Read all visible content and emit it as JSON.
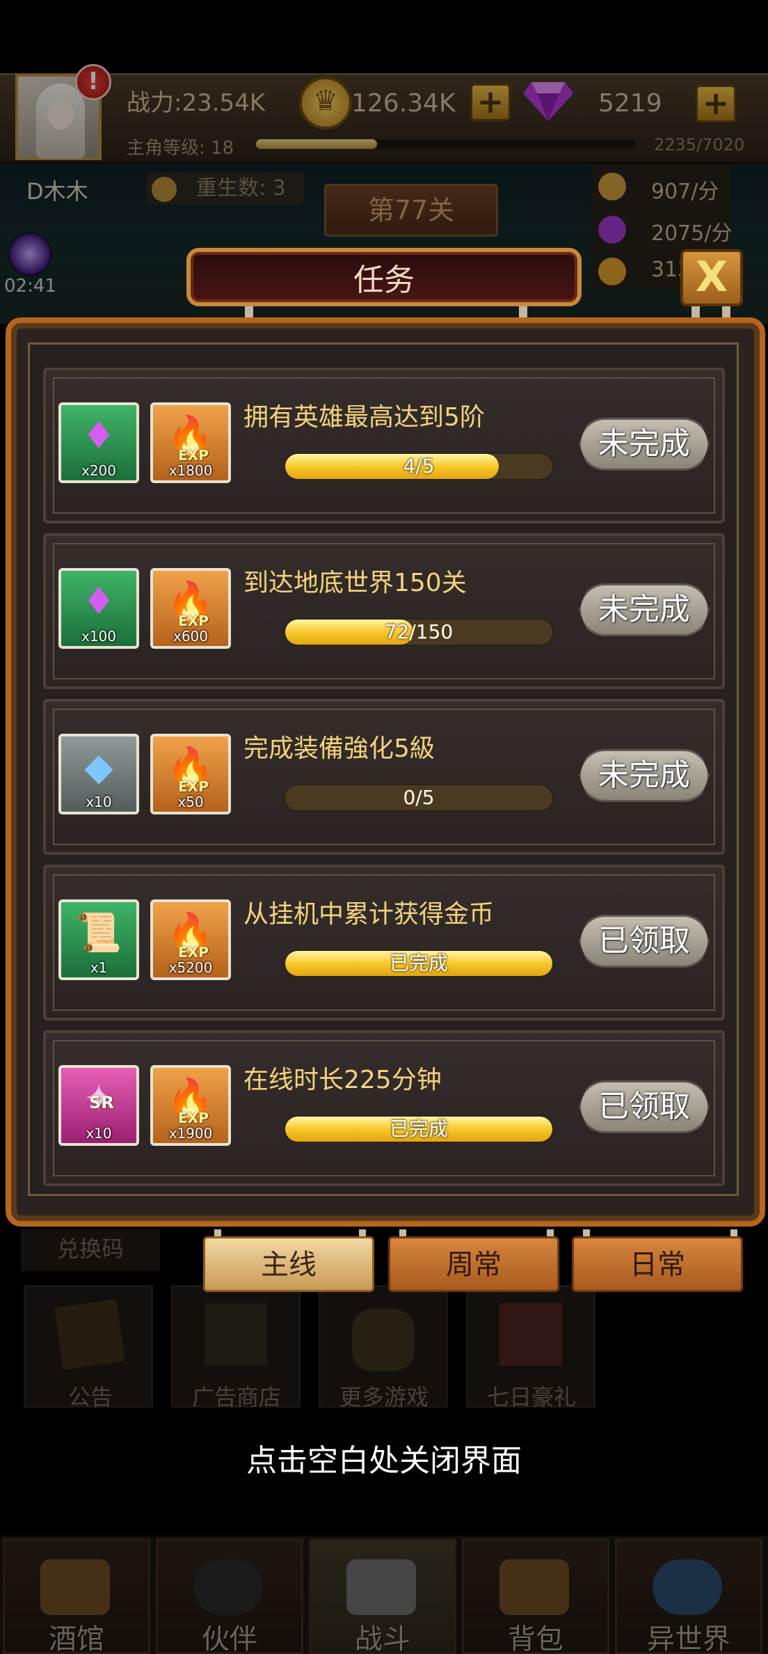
{
  "header": {
    "power": "战力:23.54K",
    "gold": "126.34K",
    "gems": "5219",
    "level_label": "主角等级: 18",
    "level_progress": "2235/7020",
    "level_fraction": 0.318,
    "alert": "!"
  },
  "scene": {
    "player_name": "D木木",
    "rebirth": "重生数: 3",
    "stage": "第77关",
    "rates": [
      "907/分",
      "2075/分",
      "313"
    ],
    "time": "02:41"
  },
  "dialog": {
    "title": "任务",
    "close_label": "X",
    "tasks": [
      {
        "title": "拥有英雄最高达到5阶",
        "progress_text": "4/5",
        "progress": 0.8,
        "status": "未完成",
        "rewards": [
          {
            "icon": "gem-icon",
            "qty": "x200",
            "color": "green"
          },
          {
            "icon": "exp-icon",
            "qty": "x1800",
            "color": "orange"
          }
        ]
      },
      {
        "title": "到达地底世界150关",
        "progress_text": "72/150",
        "progress": 0.48,
        "status": "未完成",
        "rewards": [
          {
            "icon": "gem-icon",
            "qty": "x100",
            "color": "green"
          },
          {
            "icon": "exp-icon",
            "qty": "x600",
            "color": "orange"
          }
        ]
      },
      {
        "title": "完成装備強化5級",
        "progress_text": "0/5",
        "progress": 0,
        "status": "未完成",
        "rewards": [
          {
            "icon": "crystal-icon",
            "qty": "x10",
            "color": "gray"
          },
          {
            "icon": "exp-icon",
            "qty": "x50",
            "color": "orange"
          }
        ]
      },
      {
        "title": "从挂机中累计获得金币",
        "progress_text": "已完成",
        "progress": 1,
        "status": "已领取",
        "rewards": [
          {
            "icon": "scroll-icon",
            "qty": "x1",
            "color": "green"
          },
          {
            "icon": "exp-icon",
            "qty": "x5200",
            "color": "orange"
          }
        ]
      },
      {
        "title": "在线时长225分钟",
        "progress_text": "已完成",
        "progress": 1,
        "status": "已领取",
        "rewards": [
          {
            "icon": "sr-card-icon",
            "qty": "x10",
            "color": "pink"
          },
          {
            "icon": "exp-icon",
            "qty": "x1900",
            "color": "orange"
          }
        ]
      }
    ],
    "exp_tag": "EXP",
    "sr_tag": "SR",
    "tabs": [
      "主线",
      "周常",
      "日常"
    ],
    "active_tab": 0
  },
  "background_menu": {
    "redeem": "兑换码",
    "items": [
      "公告",
      "广告商店",
      "更多游戏",
      "七日豪礼"
    ]
  },
  "hint": "点击空白处关闭界面",
  "bottom_nav": [
    "酒馆",
    "伙伴",
    "战斗",
    "背包",
    "异世界"
  ],
  "colors": {
    "panel_border": "#b8651f",
    "task_title": "#f3d37c",
    "bar_fill": "#f7c92a"
  }
}
